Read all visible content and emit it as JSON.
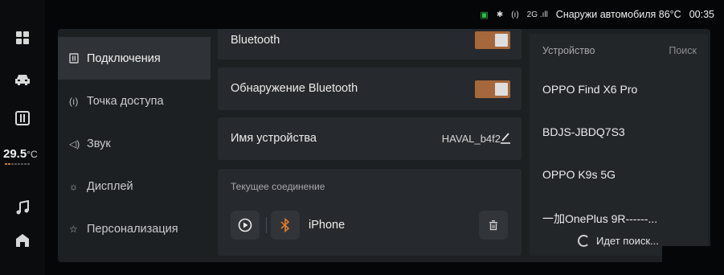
{
  "status_bar": {
    "network": "2G",
    "outside_label": "Снаружи автомобиля 86°C",
    "time": "00:35"
  },
  "dock": {
    "temperature_value": "29.5",
    "temperature_unit": "°C",
    "temperature_level": 0.15,
    "items": [
      "apps-icon",
      "car-icon",
      "parking-icon",
      "music-icon",
      "home-icon"
    ]
  },
  "nav": {
    "items": [
      {
        "label": "Подключения",
        "icon": "connections-icon",
        "active": true
      },
      {
        "label": "Точка доступа",
        "icon": "hotspot-icon",
        "active": false
      },
      {
        "label": "Звук",
        "icon": "sound-icon",
        "active": false
      },
      {
        "label": "Дисплей",
        "icon": "display-icon",
        "active": false
      },
      {
        "label": "Персонализация",
        "icon": "personalization-icon",
        "active": false
      }
    ]
  },
  "settings": {
    "bluetooth_label": "Bluetooth",
    "bluetooth_on": true,
    "discovery_label": "Обнаружение Bluetooth",
    "discovery_on": true,
    "device_name_label": "Имя устройства",
    "device_name_value": "HAVAL_b4f2",
    "current_connection_label": "Текущее соединение",
    "connected_device": "iPhone"
  },
  "device_list": {
    "header": "Устройство",
    "search_label": "Поиск",
    "devices": [
      "OPPO Find X6 Pro",
      "BDJS-JBDQ7S3",
      "OPPO K9s 5G",
      "一加OnePlus 9R------..."
    ],
    "searching_text": "Идет поиск..."
  },
  "colors": {
    "accent": "#a5673c",
    "bluetooth_icon": "#e07a2a"
  }
}
